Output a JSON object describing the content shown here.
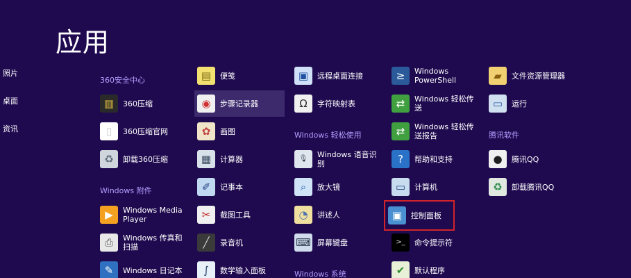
{
  "page": {
    "title": "应用"
  },
  "sidebar": [
    "照片",
    "桌面",
    "资讯"
  ],
  "groups": {
    "g360": "360安全中心",
    "gacc": "Windows 附件",
    "gease": "Windows 轻松使用",
    "gsys": "Windows 系统",
    "gqq": "腾讯软件"
  },
  "apps": [
    {
      "label": "360压缩",
      "icon": "books-icon",
      "glyph": "▥",
      "bg": "#2a2a2a",
      "fg": "#e8c040"
    },
    {
      "label": "360压缩官网",
      "icon": "document-icon",
      "glyph": "▯",
      "bg": "#ffffff",
      "fg": "#cccccc"
    },
    {
      "label": "卸载360压缩",
      "icon": "trash-icon",
      "glyph": "♻",
      "bg": "#cfd6dc",
      "fg": "#5a6a78"
    },
    {
      "label": "Windows Media\nPlayer",
      "icon": "media-player-icon",
      "glyph": "▶",
      "bg": "#f4a020",
      "fg": "#ffffff"
    },
    {
      "label": "Windows 传真和\n扫描",
      "icon": "fax-icon",
      "glyph": "⎙",
      "bg": "#e8e8e8",
      "fg": "#555555"
    },
    {
      "label": "Windows 日记本",
      "icon": "journal-icon",
      "glyph": "✎",
      "bg": "#3070c0",
      "fg": "#ffffff"
    },
    {
      "label": "便笺",
      "icon": "sticky-note-icon",
      "glyph": "▤",
      "bg": "#f2e070",
      "fg": "#7a6a10"
    },
    {
      "label": "步骤记录器",
      "icon": "steps-recorder-icon",
      "glyph": "◉",
      "bg": "#f0f0f0",
      "fg": "#d03030"
    },
    {
      "label": "画图",
      "icon": "paint-icon",
      "glyph": "✿",
      "bg": "#f0e4c8",
      "fg": "#c04040"
    },
    {
      "label": "计算器",
      "icon": "calculator-icon",
      "glyph": "▦",
      "bg": "#d8e0ea",
      "fg": "#3a4a60"
    },
    {
      "label": "记事本",
      "icon": "notepad-icon",
      "glyph": "✐",
      "bg": "#c0d8f0",
      "fg": "#204080"
    },
    {
      "label": "截图工具",
      "icon": "snipping-tool-icon",
      "glyph": "✂",
      "bg": "#f0f0f0",
      "fg": "#c02020"
    },
    {
      "label": "录音机",
      "icon": "microphone-icon",
      "glyph": "╱",
      "bg": "#3a3a3a",
      "fg": "#d0d0d0"
    },
    {
      "label": "数学输入面板",
      "icon": "math-input-icon",
      "glyph": "∫",
      "bg": "#e8f0f8",
      "fg": "#204070"
    },
    {
      "label": "远程桌面连接",
      "icon": "remote-desktop-icon",
      "glyph": "▣",
      "bg": "#d0e0f8",
      "fg": "#2050a0"
    },
    {
      "label": "字符映射表",
      "icon": "character-map-icon",
      "glyph": "Ω",
      "bg": "#f0f0f0",
      "fg": "#303030"
    },
    {
      "label": "Windows 语音识\n别",
      "icon": "speech-recognition-icon",
      "glyph": "🎙",
      "bg": "#dfe6ee",
      "fg": "#304050"
    },
    {
      "label": "放大镜",
      "icon": "magnifier-icon",
      "glyph": "⌕",
      "bg": "#d0e4f8",
      "fg": "#2060b0"
    },
    {
      "label": "讲述人",
      "icon": "narrator-icon",
      "glyph": "◔",
      "bg": "#f0e0a0",
      "fg": "#5070b0"
    },
    {
      "label": "屏幕键盘",
      "icon": "keyboard-icon",
      "glyph": "⌨",
      "bg": "#d0dceb",
      "fg": "#2a3a50"
    },
    {
      "label": "Windows\nPowerShell",
      "icon": "powershell-icon",
      "glyph": "≥",
      "bg": "#2a5a9a",
      "fg": "#ffffff"
    },
    {
      "label": "Windows 轻松传\n送",
      "icon": "easy-transfer-icon",
      "glyph": "⇄",
      "bg": "#40a040",
      "fg": "#ffffff"
    },
    {
      "label": "Windows 轻松传\n送报告",
      "icon": "easy-transfer-report-icon",
      "glyph": "⇄",
      "bg": "#40a040",
      "fg": "#ffffff"
    },
    {
      "label": "帮助和支持",
      "icon": "help-icon",
      "glyph": "?",
      "bg": "#2a72c8",
      "fg": "#ffffff"
    },
    {
      "label": "计算机",
      "icon": "computer-icon",
      "glyph": "▭",
      "bg": "#c8dcf0",
      "fg": "#2a4a80"
    },
    {
      "label": "控制面板",
      "icon": "control-panel-icon",
      "glyph": "▣",
      "bg": "#4a90d0",
      "fg": "#ffffff"
    },
    {
      "label": "命令提示符",
      "icon": "command-prompt-icon",
      "glyph": ">_",
      "bg": "#000000",
      "fg": "#dddddd"
    },
    {
      "label": "默认程序",
      "icon": "default-programs-icon",
      "glyph": "✔",
      "bg": "#e8f0d8",
      "fg": "#2a8a2a"
    },
    {
      "label": "文件资源管理器",
      "icon": "file-explorer-icon",
      "glyph": "▰",
      "bg": "#f0d070",
      "fg": "#8a6010"
    },
    {
      "label": "运行",
      "icon": "run-icon",
      "glyph": "▭",
      "bg": "#d0e0f0",
      "fg": "#2a5aa0"
    },
    {
      "label": "腾讯QQ",
      "icon": "qq-penguin-icon",
      "glyph": "●",
      "bg": "#f0f0f0",
      "fg": "#202020"
    },
    {
      "label": "卸载腾讯QQ",
      "icon": "recycle-bin-icon",
      "glyph": "♻",
      "bg": "#e0e8e0",
      "fg": "#2a8a4a"
    }
  ]
}
